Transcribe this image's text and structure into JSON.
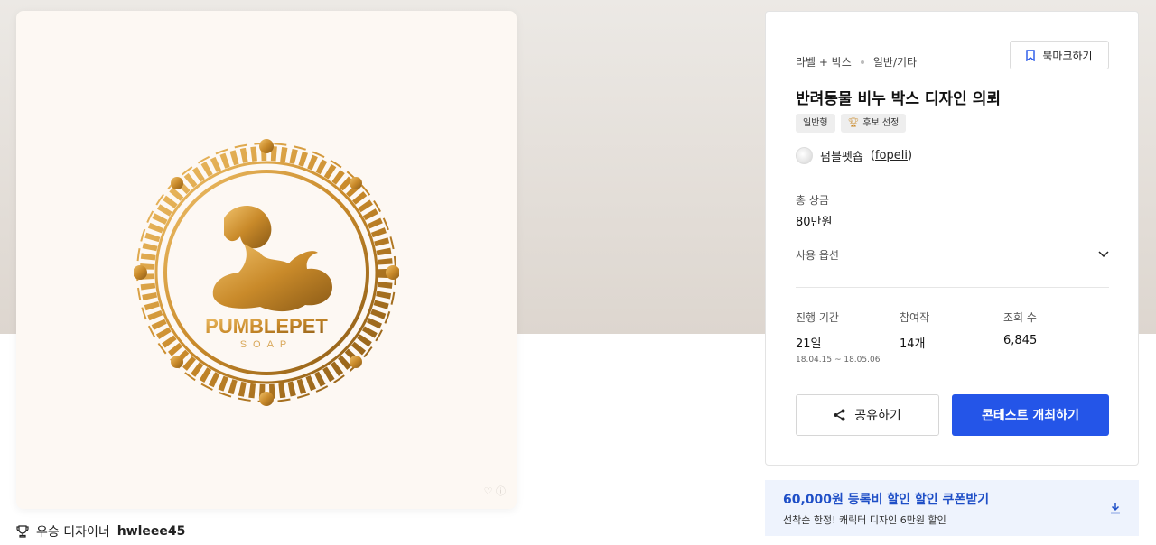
{
  "artwork": {
    "brand_name": "PUMBLEPET",
    "brand_sub": "SOAP"
  },
  "winner": {
    "label": "우승 디자이너",
    "designer": "hwleee45"
  },
  "info": {
    "breadcrumb": [
      "라벨 + 박스",
      "일반/기타"
    ],
    "bookmark_label": "북마크하기",
    "title": "반려동물 비누 박스 디자인 의뢰",
    "tags": [
      "일반형",
      "후보 선정"
    ],
    "host_name": "펌블펫숍",
    "host_handle": "fopeli",
    "prize_label": "총 상금",
    "prize_value": "80만원",
    "usage_label": "사용 옵션",
    "stats": [
      {
        "label": "진행 기간",
        "value": "21일",
        "sub": "18.04.15 ~ 18.05.06"
      },
      {
        "label": "참여작",
        "value": "14개"
      },
      {
        "label": "조회 수",
        "value": "6,845"
      }
    ],
    "share_label": "공유하기",
    "host_button_label": "콘테스트 개최하기"
  },
  "coupon": {
    "title": "60,000원 등록비 할인 할인 쿠폰받기",
    "subtitle": "선착순 한정! 캐릭터 디자인 6만원 할인"
  },
  "colors": {
    "accent": "#2455e8",
    "coupon_bg": "#eef3fd",
    "gold": "#c98a2a"
  }
}
